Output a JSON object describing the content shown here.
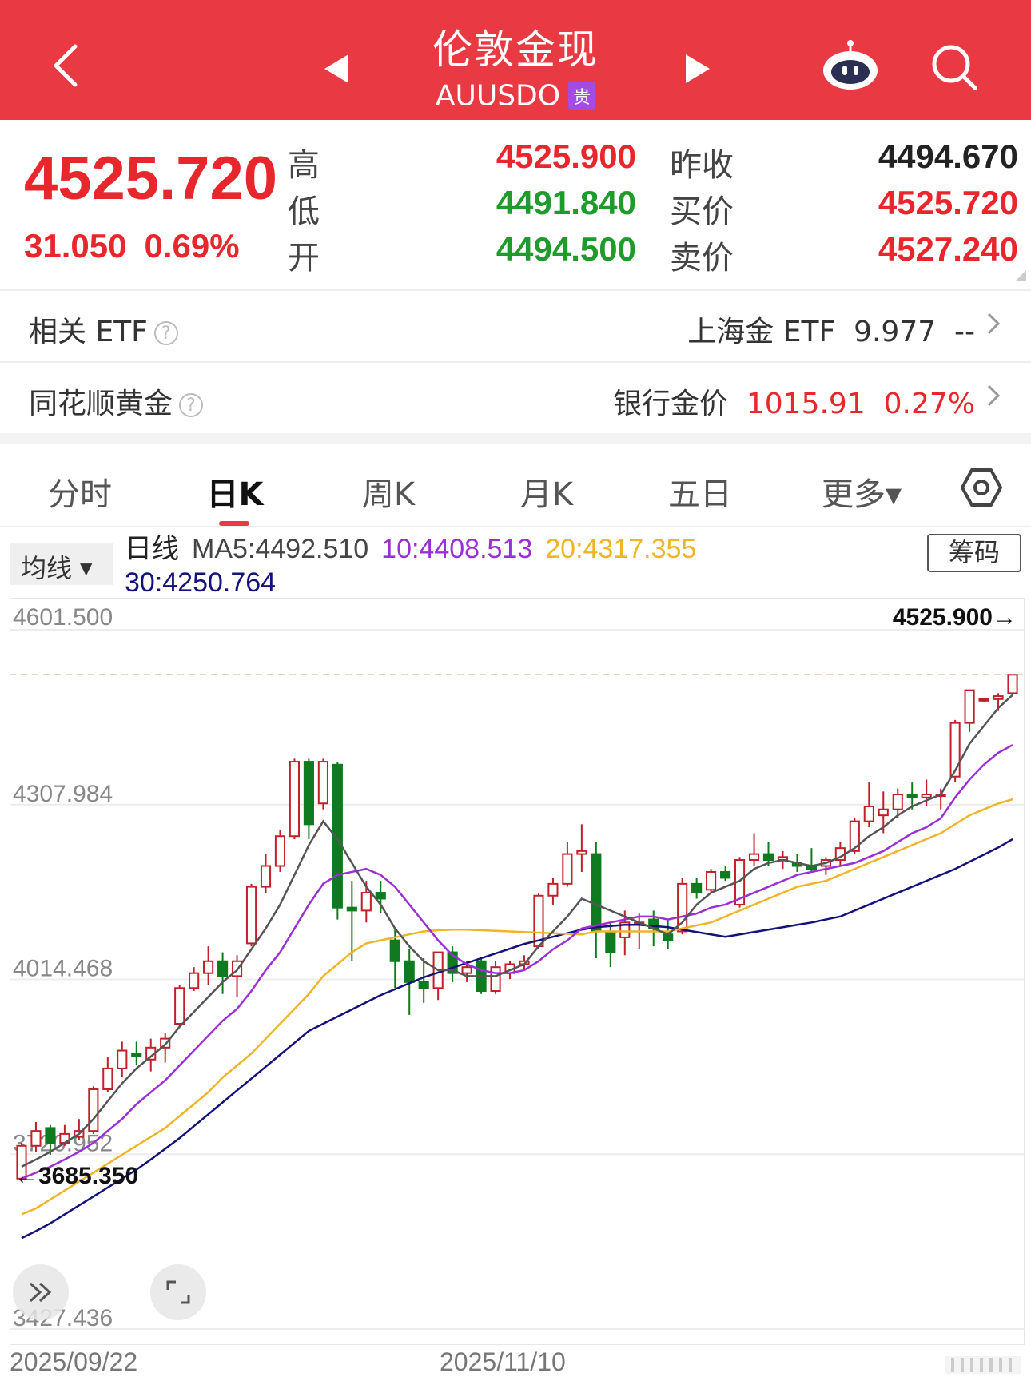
{
  "header": {
    "title": "伦敦金现",
    "code": "AUUSDO",
    "tag": "贵"
  },
  "quote": {
    "price": "4525.720",
    "change": "31.050",
    "change_pct": "0.69%",
    "labels": {
      "high": "高",
      "low": "低",
      "open": "开",
      "prev_close": "昨收",
      "bid": "买价",
      "ask": "卖价"
    },
    "high": "4525.900",
    "low": "4491.840",
    "open": "4494.500",
    "prev_close": "4494.670",
    "bid": "4525.720",
    "ask": "4527.240"
  },
  "related_etf": {
    "label": "相关 ETF",
    "name": "上海金 ETF",
    "value": "9.977",
    "change": "--"
  },
  "ths_gold": {
    "label": "同花顺黄金",
    "name": "银行金价",
    "value": "1015.91",
    "change_pct": "0.27%"
  },
  "tabs": [
    "分时",
    "日K",
    "周K",
    "月K",
    "五日",
    "更多▾"
  ],
  "active_tab": "日K",
  "ma_selector": "均线",
  "legend": {
    "period": "日线",
    "ma5": "MA5:4492.510",
    "ma10": "10:4408.513",
    "ma20": "20:4317.355",
    "ma30": "30:4250.764"
  },
  "chips_button": "筹码",
  "colors": {
    "header": "#e93a44",
    "up": "#c0202a",
    "down": "#0f7a1f",
    "ma5": "#555555",
    "ma10": "#9b2fd6",
    "ma20": "#f0b429",
    "ma30": "#12127a"
  },
  "chart_data": {
    "type": "candlestick",
    "y_ticks": [
      "4601.500",
      "4307.984",
      "4014.468",
      "3720.952",
      "3427.436"
    ],
    "ylim": [
      3427.436,
      4601.5
    ],
    "x_labels": [
      "2025/09/22",
      "2025/11/10"
    ],
    "max_marker": "4525.900→",
    "min_marker": "←3685.350",
    "candles": [
      {
        "o": 3680,
        "h": 3740,
        "l": 3675,
        "c": 3735
      },
      {
        "o": 3735,
        "h": 3775,
        "l": 3725,
        "c": 3760
      },
      {
        "o": 3765,
        "h": 3770,
        "l": 3720,
        "c": 3740
      },
      {
        "o": 3740,
        "h": 3770,
        "l": 3735,
        "c": 3755
      },
      {
        "o": 3750,
        "h": 3780,
        "l": 3745,
        "c": 3760
      },
      {
        "o": 3760,
        "h": 3835,
        "l": 3755,
        "c": 3830
      },
      {
        "o": 3830,
        "h": 3885,
        "l": 3825,
        "c": 3865
      },
      {
        "o": 3865,
        "h": 3910,
        "l": 3850,
        "c": 3895
      },
      {
        "o": 3890,
        "h": 3910,
        "l": 3870,
        "c": 3885
      },
      {
        "o": 3880,
        "h": 3915,
        "l": 3860,
        "c": 3900
      },
      {
        "o": 3900,
        "h": 3925,
        "l": 3875,
        "c": 3915
      },
      {
        "o": 3940,
        "h": 4005,
        "l": 3935,
        "c": 4000
      },
      {
        "o": 4000,
        "h": 4035,
        "l": 3995,
        "c": 4025
      },
      {
        "o": 4025,
        "h": 4070,
        "l": 4005,
        "c": 4045
      },
      {
        "o": 4045,
        "h": 4060,
        "l": 3990,
        "c": 4020
      },
      {
        "o": 4020,
        "h": 4055,
        "l": 3985,
        "c": 4045
      },
      {
        "o": 4075,
        "h": 4175,
        "l": 4070,
        "c": 4170
      },
      {
        "o": 4170,
        "h": 4225,
        "l": 4160,
        "c": 4205
      },
      {
        "o": 4205,
        "h": 4265,
        "l": 4195,
        "c": 4255
      },
      {
        "o": 4255,
        "h": 4385,
        "l": 4250,
        "c": 4380
      },
      {
        "o": 4380,
        "h": 4385,
        "l": 4250,
        "c": 4275
      },
      {
        "o": 4310,
        "h": 4385,
        "l": 4300,
        "c": 4380
      },
      {
        "o": 4375,
        "h": 4380,
        "l": 4115,
        "c": 4135
      },
      {
        "o": 4135,
        "h": 4180,
        "l": 4045,
        "c": 4130
      },
      {
        "o": 4130,
        "h": 4180,
        "l": 4110,
        "c": 4160
      },
      {
        "o": 4160,
        "h": 4180,
        "l": 4125,
        "c": 4150
      },
      {
        "o": 4080,
        "h": 4100,
        "l": 4000,
        "c": 4045
      },
      {
        "o": 4045,
        "h": 4065,
        "l": 3955,
        "c": 4010
      },
      {
        "o": 4010,
        "h": 4050,
        "l": 3975,
        "c": 4000
      },
      {
        "o": 4000,
        "h": 4060,
        "l": 3980,
        "c": 4060
      },
      {
        "o": 4060,
        "h": 4070,
        "l": 4010,
        "c": 4025
      },
      {
        "o": 4025,
        "h": 4045,
        "l": 4010,
        "c": 4035
      },
      {
        "o": 4045,
        "h": 4050,
        "l": 3990,
        "c": 3995
      },
      {
        "o": 3995,
        "h": 4045,
        "l": 3990,
        "c": 4035
      },
      {
        "o": 4025,
        "h": 4045,
        "l": 4015,
        "c": 4040
      },
      {
        "o": 4040,
        "h": 4055,
        "l": 4030,
        "c": 4045
      },
      {
        "o": 4070,
        "h": 4160,
        "l": 4065,
        "c": 4155
      },
      {
        "o": 4155,
        "h": 4185,
        "l": 4140,
        "c": 4175
      },
      {
        "o": 4175,
        "h": 4245,
        "l": 4170,
        "c": 4225
      },
      {
        "o": 4225,
        "h": 4275,
        "l": 4195,
        "c": 4230
      },
      {
        "o": 4225,
        "h": 4245,
        "l": 4050,
        "c": 4095
      },
      {
        "o": 4095,
        "h": 4110,
        "l": 4035,
        "c": 4060
      },
      {
        "o": 4085,
        "h": 4130,
        "l": 4055,
        "c": 4110
      },
      {
        "o": 4110,
        "h": 4125,
        "l": 4065,
        "c": 4110
      },
      {
        "o": 4115,
        "h": 4130,
        "l": 4070,
        "c": 4100
      },
      {
        "o": 4090,
        "h": 4115,
        "l": 4065,
        "c": 4080
      },
      {
        "o": 4095,
        "h": 4185,
        "l": 4090,
        "c": 4175
      },
      {
        "o": 4175,
        "h": 4185,
        "l": 4150,
        "c": 4160
      },
      {
        "o": 4165,
        "h": 4200,
        "l": 4160,
        "c": 4195
      },
      {
        "o": 4195,
        "h": 4205,
        "l": 4180,
        "c": 4185
      },
      {
        "o": 4140,
        "h": 4220,
        "l": 4135,
        "c": 4215
      },
      {
        "o": 4215,
        "h": 4260,
        "l": 4205,
        "c": 4225
      },
      {
        "o": 4225,
        "h": 4245,
        "l": 4205,
        "c": 4215
      },
      {
        "o": 4215,
        "h": 4230,
        "l": 4200,
        "c": 4220
      },
      {
        "o": 4210,
        "h": 4225,
        "l": 4195,
        "c": 4205
      },
      {
        "o": 4205,
        "h": 4235,
        "l": 4195,
        "c": 4200
      },
      {
        "o": 4205,
        "h": 4220,
        "l": 4190,
        "c": 4215
      },
      {
        "o": 4215,
        "h": 4245,
        "l": 4205,
        "c": 4235
      },
      {
        "o": 4230,
        "h": 4285,
        "l": 4225,
        "c": 4280
      },
      {
        "o": 4280,
        "h": 4345,
        "l": 4270,
        "c": 4305
      },
      {
        "o": 4290,
        "h": 4330,
        "l": 4260,
        "c": 4300
      },
      {
        "o": 4300,
        "h": 4335,
        "l": 4285,
        "c": 4325
      },
      {
        "o": 4325,
        "h": 4345,
        "l": 4300,
        "c": 4320
      },
      {
        "o": 4320,
        "h": 4350,
        "l": 4305,
        "c": 4325
      },
      {
        "o": 4325,
        "h": 4335,
        "l": 4300,
        "c": 4325
      },
      {
        "o": 4355,
        "h": 4450,
        "l": 4345,
        "c": 4445
      },
      {
        "o": 4445,
        "h": 4500,
        "l": 4430,
        "c": 4500
      },
      {
        "o": 4485,
        "h": 4485,
        "l": 4480,
        "c": 4485
      },
      {
        "o": 4485,
        "h": 4495,
        "l": 4465,
        "c": 4490
      },
      {
        "o": 4495,
        "h": 4526,
        "l": 4492,
        "c": 4526
      }
    ],
    "ma5": [
      3700,
      3712,
      3725,
      3740,
      3755,
      3780,
      3810,
      3840,
      3865,
      3885,
      3905,
      3935,
      3960,
      3985,
      4010,
      4030,
      4065,
      4100,
      4140,
      4190,
      4240,
      4280,
      4250,
      4210,
      4170,
      4140,
      4100,
      4070,
      4045,
      4030,
      4030,
      4020,
      4020,
      4020,
      4030,
      4040,
      4070,
      4095,
      4120,
      4150,
      4140,
      4130,
      4120,
      4110,
      4100,
      4090,
      4110,
      4140,
      4160,
      4170,
      4180,
      4200,
      4210,
      4215,
      4210,
      4205,
      4210,
      4220,
      4235,
      4255,
      4270,
      4290,
      4305,
      4315,
      4325,
      4365,
      4410,
      4440,
      4470,
      4492
    ],
    "ma10": [
      3680,
      3690,
      3700,
      3712,
      3725,
      3740,
      3760,
      3780,
      3805,
      3825,
      3845,
      3870,
      3895,
      3920,
      3945,
      3965,
      3995,
      4030,
      4060,
      4100,
      4140,
      4175,
      4190,
      4195,
      4200,
      4190,
      4170,
      4140,
      4110,
      4080,
      4055,
      4040,
      4030,
      4025,
      4025,
      4030,
      4045,
      4065,
      4080,
      4100,
      4105,
      4110,
      4115,
      4120,
      4120,
      4115,
      4120,
      4125,
      4135,
      4140,
      4150,
      4160,
      4170,
      4180,
      4190,
      4195,
      4200,
      4205,
      4210,
      4220,
      4230,
      4245,
      4260,
      4270,
      4285,
      4320,
      4350,
      4375,
      4395,
      4408
    ],
    "ma20": [
      3620,
      3630,
      3645,
      3660,
      3675,
      3690,
      3705,
      3720,
      3735,
      3750,
      3765,
      3785,
      3805,
      3825,
      3850,
      3870,
      3890,
      3915,
      3940,
      3965,
      3990,
      4020,
      4040,
      4060,
      4075,
      4080,
      4085,
      4090,
      4095,
      4097,
      4098,
      4098,
      4097,
      4096,
      4095,
      4094,
      4093,
      4092,
      4091,
      4090,
      4095,
      4095,
      4095,
      4095,
      4095,
      4095,
      4100,
      4105,
      4110,
      4120,
      4130,
      4140,
      4150,
      4160,
      4170,
      4175,
      4180,
      4190,
      4200,
      4210,
      4220,
      4230,
      4240,
      4250,
      4260,
      4275,
      4290,
      4300,
      4310,
      4317
    ],
    "ma30": [
      3580,
      3592,
      3605,
      3620,
      3635,
      3650,
      3665,
      3680,
      3695,
      3712,
      3730,
      3748,
      3768,
      3788,
      3808,
      3828,
      3848,
      3868,
      3888,
      3908,
      3928,
      3940,
      3952,
      3964,
      3976,
      3988,
      3998,
      4008,
      4018,
      4026,
      4034,
      4042,
      4050,
      4058,
      4066,
      4074,
      4080,
      4086,
      4092,
      4098,
      4102,
      4104,
      4106,
      4106,
      4104,
      4102,
      4098,
      4094,
      4090,
      4086,
      4090,
      4094,
      4098,
      4102,
      4106,
      4110,
      4115,
      4120,
      4130,
      4140,
      4150,
      4160,
      4170,
      4180,
      4190,
      4200,
      4212,
      4224,
      4236,
      4250
    ]
  }
}
